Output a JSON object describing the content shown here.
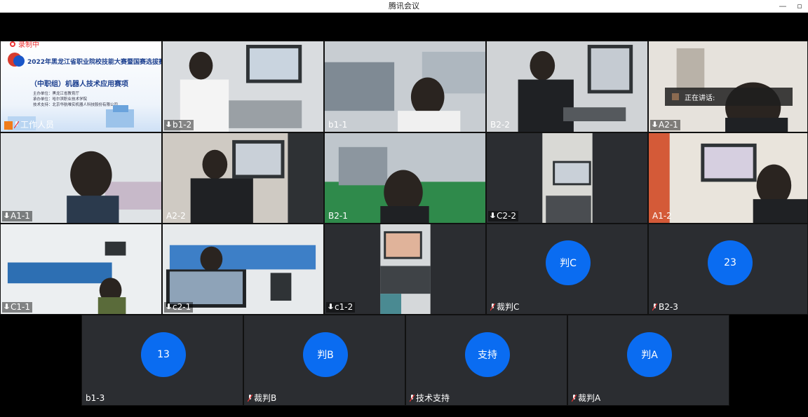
{
  "window": {
    "title": "腾讯会议",
    "controls": [
      "—",
      "▫",
      "✕"
    ]
  },
  "recording": {
    "label": "录制中"
  },
  "speaking": {
    "label": "正在讲话:"
  },
  "slide": {
    "title": "2022年黑龙江省职业院校技能大赛暨国赛选拔赛",
    "subtitle": "（中职组）机器人技术应用赛项",
    "lines": [
      "主办单位：黑龙江省教育厅",
      "承办单位：哈尔滨职业技术学院",
      "技术支持：北京华航唯实机器人科技股份有限公司"
    ]
  },
  "tiles": [
    {
      "name": "工作人员"
    },
    {
      "name": "b1-2"
    },
    {
      "name": "b1-1"
    },
    {
      "name": "B2-2"
    },
    {
      "name": "A2-1"
    },
    {
      "name": "A1-1"
    },
    {
      "name": "A2-2"
    },
    {
      "name": "B2-1"
    },
    {
      "name": "C2-2"
    },
    {
      "name": "A1-2"
    },
    {
      "name": "C1-1"
    },
    {
      "name": "c2-1"
    },
    {
      "name": "c1-2"
    },
    {
      "name": "裁判C",
      "avatar": "判C"
    },
    {
      "name": "B2-3",
      "avatar": "23"
    },
    {
      "name": "b1-3",
      "avatar": "13"
    },
    {
      "name": "裁判B",
      "avatar": "判B"
    },
    {
      "name": "技术支持",
      "avatar": "支持"
    },
    {
      "name": "裁判A",
      "avatar": "判A"
    }
  ],
  "colors": {
    "avatar": "#0a6cf1",
    "tile_bg": "#2b2d31",
    "recording": "#e33333"
  }
}
